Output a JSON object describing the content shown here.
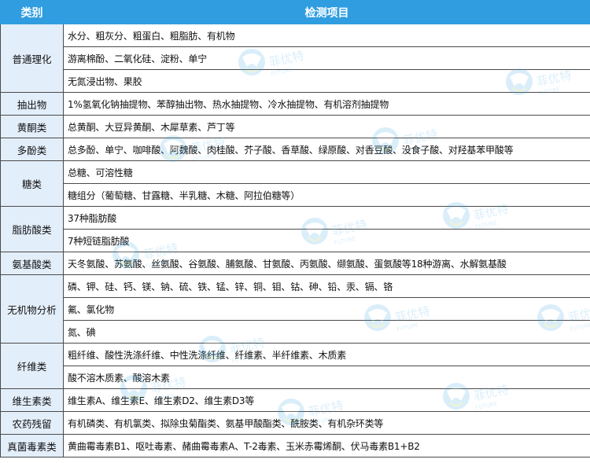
{
  "header": {
    "col1": "类别",
    "col2": "检测项目"
  },
  "groups": [
    {
      "category": "普通理化",
      "items": [
        "水分、粗灰分、粗蛋白、粗脂肪、有机物",
        "游离棉酚、二氧化硅、淀粉、单宁",
        "无氮浸出物、果胶"
      ]
    },
    {
      "category": "抽出物",
      "items": [
        "1%氢氧化钠抽提物、苯醇抽出物、热水抽提物、冷水抽提物、有机溶剂抽提物"
      ]
    },
    {
      "category": "黄酮类",
      "items": [
        "总黄酮、大豆异黄酮、木犀草素、芦丁等"
      ]
    },
    {
      "category": "多酚类",
      "items": [
        "总多酚、单宁、咖啡酸、阿魏酸、肉桂酸、芥子酸、香草酸、绿原酸、对香豆酸、没食子酸、对羟基苯甲酸等"
      ]
    },
    {
      "category": "糖类",
      "items": [
        "总糖、可溶性糖",
        "糖组分（葡萄糖、甘露糖、半乳糖、木糖、阿拉伯糖等）"
      ]
    },
    {
      "category": "脂肪酸类",
      "items": [
        "37种脂肪酸",
        "7种短链脂肪酸"
      ]
    },
    {
      "category": "氨基酸类",
      "items": [
        "天冬氨酸、苏氨酸、丝氨酸、谷氨酸、脯氨酸、甘氨酸、丙氨酸、缬氨酸、蛋氨酸等18种游离、水解氨基酸"
      ]
    },
    {
      "category": "无机物分析",
      "items": [
        "磷、钾、硅、钙、镁、钠、硫、铁、锰、锌、铜、钼、钴、砷、铅、汞、镉、铬",
        "氟、氯化物",
        "氮、碘"
      ]
    },
    {
      "category": "纤维类",
      "items": [
        "粗纤维、酸性洗涤纤维、中性洗涤纤维、纤维素、半纤维素、木质素",
        "酸不溶木质素、酸溶木素"
      ]
    },
    {
      "category": "维生素类",
      "items": [
        "维生素A、维生素E、维生素D2、维生素D3等"
      ]
    },
    {
      "category": "农药残留",
      "items": [
        "有机磷类、有机氯类、拟除虫菊酯类、氨基甲酸酯类、酰胺类、有机杂环类等"
      ]
    },
    {
      "category": "真菌毒素类",
      "items": [
        "黄曲霉毒素B1、呕吐毒素、赭曲霉毒素A、T-2毒素、玉米赤霉烯酮、伏马毒素B1+B2"
      ]
    }
  ],
  "colors": {
    "header_bg": "#2f9de0",
    "category_bg": "#e3eefb",
    "border": "#4a4a4a"
  },
  "watermark": {
    "icon": "logo-icon",
    "text": "菲优特",
    "subtext": "FUTURE"
  }
}
